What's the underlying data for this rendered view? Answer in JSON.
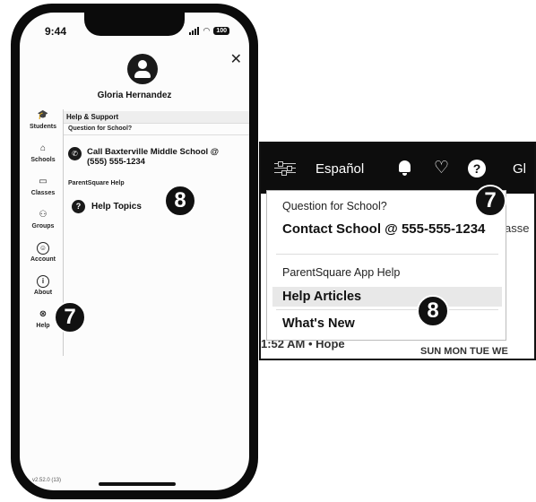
{
  "phone": {
    "time": "9:44",
    "battery": "100",
    "user_name": "Gloria Hernandez",
    "nav": [
      {
        "label": "Students",
        "icon": "graduation-cap-icon",
        "glyph": "🎓"
      },
      {
        "label": "Schools",
        "icon": "school-icon",
        "glyph": "⌂"
      },
      {
        "label": "Classes",
        "icon": "classes-icon",
        "glyph": "▭"
      },
      {
        "label": "Groups",
        "icon": "groups-icon",
        "glyph": "⚇"
      },
      {
        "label": "Account",
        "icon": "account-icon",
        "glyph": "☺"
      },
      {
        "label": "About",
        "icon": "info-icon",
        "glyph": "i"
      },
      {
        "label": "Help",
        "icon": "lifebuoy-icon",
        "glyph": "⊗"
      }
    ],
    "help_title": "Help & Support",
    "question_label": "Question for School?",
    "call_text": "Call Baxterville Middle School @ (555) 555-1234",
    "app_help_label": "ParentSquare Help",
    "help_topics": "Help Topics",
    "version": "v2.52.0 (13)"
  },
  "web": {
    "language": "Español",
    "gl": "Gl",
    "question_label": "Question for School?",
    "contact": "Contact School @ 555-555-1234",
    "app_help_label": "ParentSquare App Help",
    "help_articles": "Help Articles",
    "whats_new": "What's New",
    "bg_right": "asse",
    "bg_time": "1:52 AM • Hope",
    "days": "SUN MON TUE WE"
  },
  "callouts": {
    "seven": "7",
    "eight": "8"
  }
}
